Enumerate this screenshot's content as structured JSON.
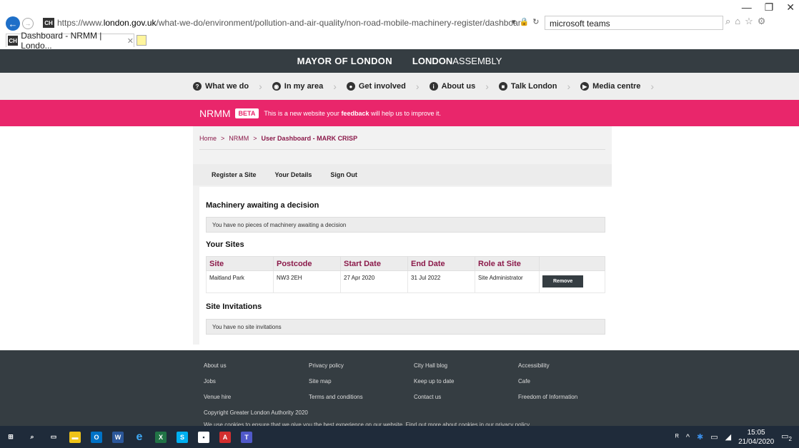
{
  "browser": {
    "window_controls": [
      "—",
      "❐",
      "✕"
    ],
    "url_domain_prefix": "https://www.",
    "url_domain": "london.gov.uk",
    "url_path": "/what-we-do/environment/pollution-and-air-quality/non-road-mobile-machinery-register/dashboard",
    "favicon_text": "CH",
    "search_value": "microsoft teams",
    "tab_title": "Dashboard - NRMM | Londo...",
    "tab_close": "✕"
  },
  "site_header": {
    "mayor": "MAYOR OF LONDON",
    "assembly_bold": "LONDON",
    "assembly_rest": "ASSEMBLY"
  },
  "nav": [
    {
      "label": "What we do",
      "icon": "?"
    },
    {
      "label": "In my area",
      "icon": "◉"
    },
    {
      "label": "Get involved",
      "icon": "●"
    },
    {
      "label": "About us",
      "icon": "i"
    },
    {
      "label": "Talk London",
      "icon": "■"
    },
    {
      "label": "Media centre",
      "icon": "▶"
    }
  ],
  "banner": {
    "title": "NRMM",
    "badge": "BETA",
    "msg_pre": "This is a new website your ",
    "msg_link": "feedback",
    "msg_post": " will help us to improve it."
  },
  "breadcrumb": {
    "home": "Home",
    "sep": ">",
    "nrmm": "NRMM",
    "current": "User Dashboard - MARK CRISP"
  },
  "tabs": [
    "Register a Site",
    "Your Details",
    "Sign Out"
  ],
  "dashboard": {
    "machinery_heading": "Machinery awaiting a decision",
    "machinery_notice": "You have no pieces of machinery awaiting a decision",
    "sites_heading": "Your Sites",
    "columns": [
      "Site",
      "Postcode",
      "Start Date",
      "End Date",
      "Role at Site"
    ],
    "rows": [
      {
        "site": "Maitland Park",
        "postcode": "NW3 2EH",
        "start": "27 Apr 2020",
        "end": "31 Jul 2022",
        "role": "Site Administrator",
        "action": "Remove"
      }
    ],
    "invitations_heading": "Site Invitations",
    "invitations_notice": "You have no site invitations"
  },
  "footer": {
    "col1": [
      "About us",
      "Jobs",
      "Venue hire"
    ],
    "col2": [
      "Privacy policy",
      "Site map",
      "Terms and conditions"
    ],
    "col3": [
      "City Hall blog",
      "Keep up to date",
      "Contact us"
    ],
    "col4": [
      "Accessibility",
      "Cafe",
      "Freedom of Information"
    ],
    "copyright": "Copyright Greater London Authority 2020",
    "cookie": "We use cookies to ensure that we give you the best experience on our website. Find out more about cookies in our privacy policy"
  },
  "taskbar": {
    "apps": [
      {
        "name": "windows-start",
        "glyph": "⊞",
        "color": "transparent"
      },
      {
        "name": "search",
        "glyph": "⌕",
        "color": "transparent"
      },
      {
        "name": "task-view",
        "glyph": "▭",
        "color": "transparent"
      },
      {
        "name": "file-explorer",
        "glyph": "▬",
        "color": "#f0c419"
      },
      {
        "name": "outlook",
        "glyph": "O",
        "color": "#0072c6"
      },
      {
        "name": "word",
        "glyph": "W",
        "color": "#2b579a"
      },
      {
        "name": "internet-explorer",
        "glyph": "e",
        "color": "transparent"
      },
      {
        "name": "excel",
        "glyph": "X",
        "color": "#217346"
      },
      {
        "name": "skype",
        "glyph": "S",
        "color": "#00aff0"
      },
      {
        "name": "app-box",
        "glyph": "▪",
        "color": "#ffffff"
      },
      {
        "name": "acrobat",
        "glyph": "A",
        "color": "#d32f2f"
      },
      {
        "name": "teams",
        "glyph": "T",
        "color": "#5059c9"
      }
    ],
    "time": "15:05",
    "date": "21/04/2020",
    "notif_count": "2"
  }
}
